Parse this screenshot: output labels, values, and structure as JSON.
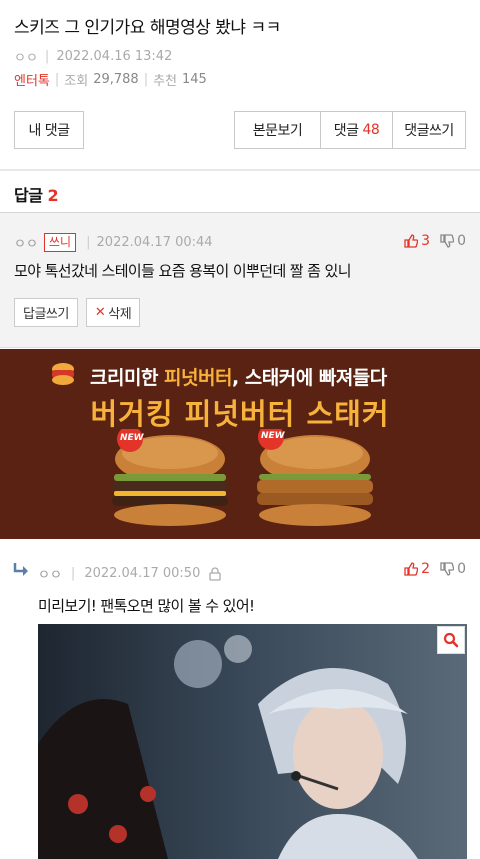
{
  "post": {
    "title": "스키즈 그 인기가요 해명영상 봤냐 ㅋㅋ",
    "author": "ㅇㅇ",
    "date": "2022.04.16 13:42",
    "category": "엔터톡",
    "views_label": "조회",
    "views": "29,788",
    "recommend_label": "추천",
    "recommend": "145"
  },
  "buttons": {
    "my_comments": "내 댓글",
    "view_post": "본문보기",
    "comments_label": "댓글",
    "comments_count": "48",
    "write_comment": "댓글쓰기"
  },
  "replies": {
    "label": "답글",
    "count": "2"
  },
  "comment1": {
    "author": "ㅇㅇ",
    "badge": "쓰니",
    "date": "2022.04.17 00:44",
    "up": "3",
    "down": "0",
    "text": "모야 톡선갔네 스테이들 요즘 용복이 이뿌던데 짤 좀 있니",
    "reply_btn": "답글쓰기",
    "delete_btn": "삭제"
  },
  "ad": {
    "brand": "BURGER KING",
    "line1_pre": "크리미한 ",
    "line1_hl": "피넛버터",
    "line1_post": ", 스태커에 빠져들다",
    "line2": "버거킹 피넛버터 스태커",
    "new_label": "NEW"
  },
  "comment2": {
    "author": "ㅇㅇ",
    "date": "2022.04.17 00:50",
    "up": "2",
    "down": "0",
    "text": "미리보기! 팬톡오면 많이 볼 수 있어!"
  },
  "colors": {
    "accent": "#e3342a",
    "ad_bg": "#5a2212",
    "ad_yellow": "#f7b23b"
  }
}
